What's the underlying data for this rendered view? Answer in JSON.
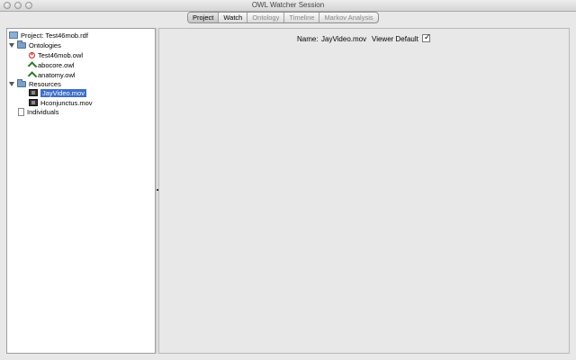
{
  "window": {
    "title": "OWL Watcher Session"
  },
  "tabs": [
    {
      "label": "Project",
      "state": "active"
    },
    {
      "label": "Watch",
      "state": "enabled"
    },
    {
      "label": "Ontology",
      "state": "disabled"
    },
    {
      "label": "Timeline",
      "state": "disabled"
    },
    {
      "label": "Markov Analysis",
      "state": "disabled"
    }
  ],
  "tree": {
    "project": "Project: Test46mob.rdf",
    "ontologies": {
      "label": "Ontologies",
      "items": [
        "Test46mob.owl",
        "abocore.owl",
        "anatomy.owl"
      ]
    },
    "resources": {
      "label": "Resources",
      "items": [
        "JayVideo.mov",
        "Hconjunctus.mov"
      ],
      "selected": "JayVideo.mov"
    },
    "individuals": "Individuals"
  },
  "details": {
    "name_label": "Name:",
    "name_value": "JayVideo.mov",
    "viewer_default_label": "Viewer Default",
    "viewer_default_checked": true
  },
  "icons": {
    "project": "project-icon",
    "folder": "folder-icon",
    "error": "error-icon",
    "owl": "owl-icon",
    "movie": "movie-icon",
    "document": "document-icon"
  },
  "colors": {
    "selection": "#3d6ec9",
    "error": "#cc2222",
    "owl": "#2a7a2a"
  }
}
